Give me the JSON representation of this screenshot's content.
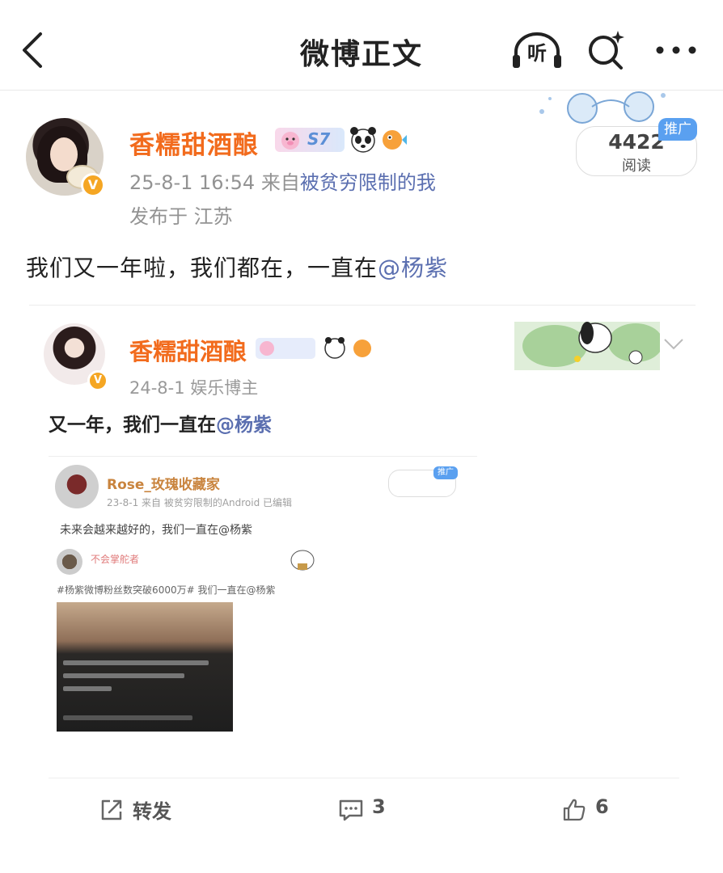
{
  "nav": {
    "title": "微博正文",
    "listen_label": "听"
  },
  "post": {
    "username": "香糯甜酒酿",
    "level_badge": "S7",
    "timestamp": "25-8-1 16:54",
    "source_prefix": "来自",
    "source": "被贫穷限制的我",
    "location": "发布于 江苏",
    "read_count": "4422",
    "read_label": "阅读",
    "promo_tag": "推广",
    "text": "我们又一年啦，我们都在，一直在",
    "mention": "@杨紫"
  },
  "embedded": {
    "username": "香糯甜酒酿",
    "meta": "24-8-1  娱乐博主",
    "text": "又一年，我们一直在",
    "mention": "@杨紫",
    "inner": {
      "username": "Rose_玫瑰收藏家",
      "meta": "23-8-1  来自 被贫穷限制的Android  已编辑",
      "promo": "推广",
      "text": "未来会越来越好的，我们一直在@杨紫",
      "nested_username": "不会掌舵者",
      "nested_text": "#杨紫微博粉丝数突破6000万# 我们一直在@杨紫"
    }
  },
  "actions": {
    "repost_label": "转发",
    "comment_count": "3",
    "like_count": "6"
  },
  "colors": {
    "username": "#f26b1d",
    "link": "#5b6fb0",
    "meta": "#939393",
    "promo": "#5aa0f0",
    "verified": "#f5a623"
  }
}
